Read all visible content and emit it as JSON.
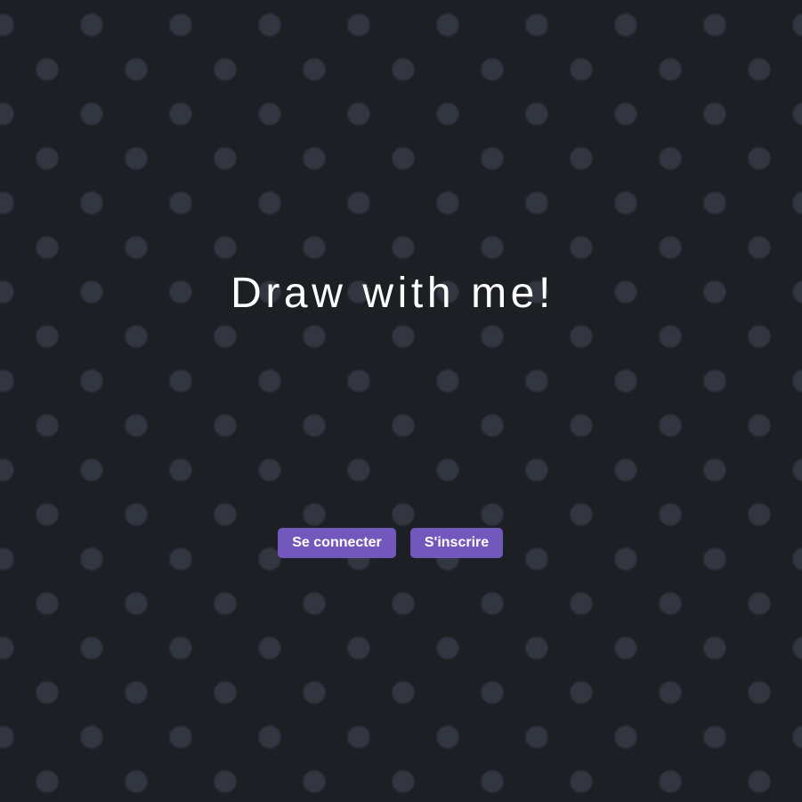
{
  "page": {
    "title": "Draw with me!"
  },
  "actions": {
    "login_label": "Se connecter",
    "register_label": "S'inscrire"
  },
  "colors": {
    "background": "#1c1f24",
    "dots": "#323640",
    "button": "#7258bc",
    "text": "#ffffff"
  }
}
